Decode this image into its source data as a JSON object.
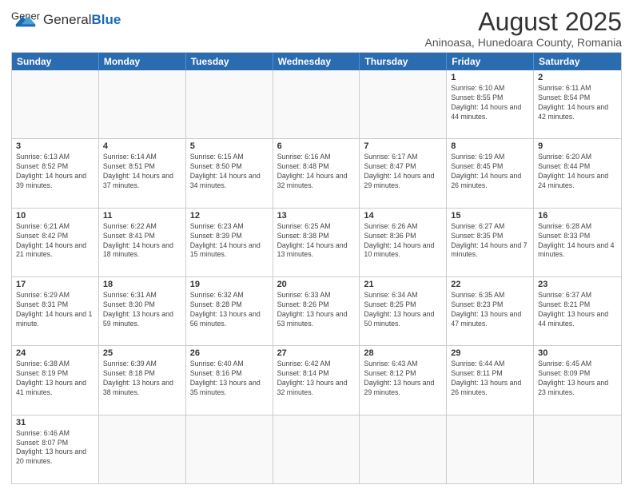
{
  "header": {
    "logo_general": "General",
    "logo_blue": "Blue",
    "month_year": "August 2025",
    "location": "Aninoasa, Hunedoara County, Romania"
  },
  "weekdays": [
    "Sunday",
    "Monday",
    "Tuesday",
    "Wednesday",
    "Thursday",
    "Friday",
    "Saturday"
  ],
  "weeks": [
    [
      {
        "day": "",
        "info": ""
      },
      {
        "day": "",
        "info": ""
      },
      {
        "day": "",
        "info": ""
      },
      {
        "day": "",
        "info": ""
      },
      {
        "day": "",
        "info": ""
      },
      {
        "day": "1",
        "info": "Sunrise: 6:10 AM\nSunset: 8:55 PM\nDaylight: 14 hours and 44 minutes."
      },
      {
        "day": "2",
        "info": "Sunrise: 6:11 AM\nSunset: 8:54 PM\nDaylight: 14 hours and 42 minutes."
      }
    ],
    [
      {
        "day": "3",
        "info": "Sunrise: 6:13 AM\nSunset: 8:52 PM\nDaylight: 14 hours and 39 minutes."
      },
      {
        "day": "4",
        "info": "Sunrise: 6:14 AM\nSunset: 8:51 PM\nDaylight: 14 hours and 37 minutes."
      },
      {
        "day": "5",
        "info": "Sunrise: 6:15 AM\nSunset: 8:50 PM\nDaylight: 14 hours and 34 minutes."
      },
      {
        "day": "6",
        "info": "Sunrise: 6:16 AM\nSunset: 8:48 PM\nDaylight: 14 hours and 32 minutes."
      },
      {
        "day": "7",
        "info": "Sunrise: 6:17 AM\nSunset: 8:47 PM\nDaylight: 14 hours and 29 minutes."
      },
      {
        "day": "8",
        "info": "Sunrise: 6:19 AM\nSunset: 8:45 PM\nDaylight: 14 hours and 26 minutes."
      },
      {
        "day": "9",
        "info": "Sunrise: 6:20 AM\nSunset: 8:44 PM\nDaylight: 14 hours and 24 minutes."
      }
    ],
    [
      {
        "day": "10",
        "info": "Sunrise: 6:21 AM\nSunset: 8:42 PM\nDaylight: 14 hours and 21 minutes."
      },
      {
        "day": "11",
        "info": "Sunrise: 6:22 AM\nSunset: 8:41 PM\nDaylight: 14 hours and 18 minutes."
      },
      {
        "day": "12",
        "info": "Sunrise: 6:23 AM\nSunset: 8:39 PM\nDaylight: 14 hours and 15 minutes."
      },
      {
        "day": "13",
        "info": "Sunrise: 6:25 AM\nSunset: 8:38 PM\nDaylight: 14 hours and 13 minutes."
      },
      {
        "day": "14",
        "info": "Sunrise: 6:26 AM\nSunset: 8:36 PM\nDaylight: 14 hours and 10 minutes."
      },
      {
        "day": "15",
        "info": "Sunrise: 6:27 AM\nSunset: 8:35 PM\nDaylight: 14 hours and 7 minutes."
      },
      {
        "day": "16",
        "info": "Sunrise: 6:28 AM\nSunset: 8:33 PM\nDaylight: 14 hours and 4 minutes."
      }
    ],
    [
      {
        "day": "17",
        "info": "Sunrise: 6:29 AM\nSunset: 8:31 PM\nDaylight: 14 hours and 1 minute."
      },
      {
        "day": "18",
        "info": "Sunrise: 6:31 AM\nSunset: 8:30 PM\nDaylight: 13 hours and 59 minutes."
      },
      {
        "day": "19",
        "info": "Sunrise: 6:32 AM\nSunset: 8:28 PM\nDaylight: 13 hours and 56 minutes."
      },
      {
        "day": "20",
        "info": "Sunrise: 6:33 AM\nSunset: 8:26 PM\nDaylight: 13 hours and 53 minutes."
      },
      {
        "day": "21",
        "info": "Sunrise: 6:34 AM\nSunset: 8:25 PM\nDaylight: 13 hours and 50 minutes."
      },
      {
        "day": "22",
        "info": "Sunrise: 6:35 AM\nSunset: 8:23 PM\nDaylight: 13 hours and 47 minutes."
      },
      {
        "day": "23",
        "info": "Sunrise: 6:37 AM\nSunset: 8:21 PM\nDaylight: 13 hours and 44 minutes."
      }
    ],
    [
      {
        "day": "24",
        "info": "Sunrise: 6:38 AM\nSunset: 8:19 PM\nDaylight: 13 hours and 41 minutes."
      },
      {
        "day": "25",
        "info": "Sunrise: 6:39 AM\nSunset: 8:18 PM\nDaylight: 13 hours and 38 minutes."
      },
      {
        "day": "26",
        "info": "Sunrise: 6:40 AM\nSunset: 8:16 PM\nDaylight: 13 hours and 35 minutes."
      },
      {
        "day": "27",
        "info": "Sunrise: 6:42 AM\nSunset: 8:14 PM\nDaylight: 13 hours and 32 minutes."
      },
      {
        "day": "28",
        "info": "Sunrise: 6:43 AM\nSunset: 8:12 PM\nDaylight: 13 hours and 29 minutes."
      },
      {
        "day": "29",
        "info": "Sunrise: 6:44 AM\nSunset: 8:11 PM\nDaylight: 13 hours and 26 minutes."
      },
      {
        "day": "30",
        "info": "Sunrise: 6:45 AM\nSunset: 8:09 PM\nDaylight: 13 hours and 23 minutes."
      }
    ],
    [
      {
        "day": "31",
        "info": "Sunrise: 6:46 AM\nSunset: 8:07 PM\nDaylight: 13 hours and 20 minutes."
      },
      {
        "day": "",
        "info": ""
      },
      {
        "day": "",
        "info": ""
      },
      {
        "day": "",
        "info": ""
      },
      {
        "day": "",
        "info": ""
      },
      {
        "day": "",
        "info": ""
      },
      {
        "day": "",
        "info": ""
      }
    ]
  ]
}
